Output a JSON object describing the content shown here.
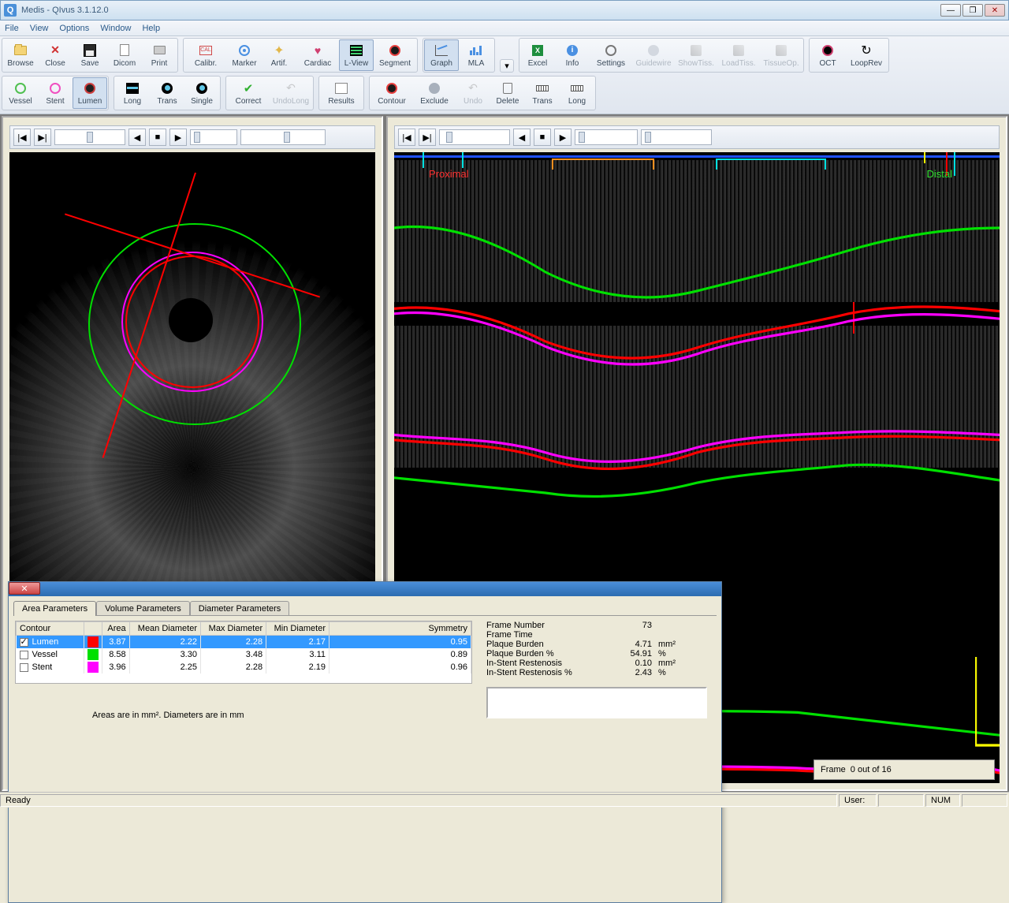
{
  "title": "Medis  -  QIvus 3.1.12.0",
  "menu": [
    "File",
    "View",
    "Options",
    "Window",
    "Help"
  ],
  "toolbar1": {
    "g1": [
      {
        "id": "browse",
        "label": "Browse",
        "icon": "ifolder"
      },
      {
        "id": "close",
        "label": "Close",
        "icon": "ix"
      },
      {
        "id": "save",
        "label": "Save",
        "icon": "idisk"
      },
      {
        "id": "dicom",
        "label": "Dicom",
        "icon": "idoc"
      },
      {
        "id": "print",
        "label": "Print",
        "icon": "iprint"
      }
    ],
    "g2": [
      {
        "id": "calibr",
        "label": "Calibr.",
        "icon": "ical"
      },
      {
        "id": "marker",
        "label": "Marker",
        "icon": "imark"
      },
      {
        "id": "artif",
        "label": "Artif.",
        "icon": "istar"
      },
      {
        "id": "cardiac",
        "label": "Cardiac",
        "icon": "iheart"
      },
      {
        "id": "lview",
        "label": "L-View",
        "icon": "ilview",
        "tog": true
      },
      {
        "id": "segment",
        "label": "Segment",
        "icon": "iseg"
      }
    ],
    "g3": [
      {
        "id": "graph",
        "label": "Graph",
        "icon": "igraph",
        "tog": true
      },
      {
        "id": "mla",
        "label": "MLA",
        "icon": "imla"
      }
    ],
    "g4": [
      {
        "id": "excel",
        "label": "Excel",
        "icon": "ixl"
      },
      {
        "id": "info",
        "label": "Info",
        "icon": "iinfo"
      },
      {
        "id": "settings",
        "label": "Settings",
        "icon": "igear"
      },
      {
        "id": "guidewire",
        "label": "Guidewire",
        "icon": "icircle",
        "disabled": true
      },
      {
        "id": "showtiss",
        "label": "ShowTiss.",
        "icon": "itool",
        "disabled": true
      },
      {
        "id": "loadtiss",
        "label": "LoadTiss.",
        "icon": "itool",
        "disabled": true
      },
      {
        "id": "tissueop",
        "label": "TissueOp.",
        "icon": "itool",
        "disabled": true
      }
    ],
    "g5": [
      {
        "id": "oct",
        "label": "OCT",
        "icon": "ioct"
      },
      {
        "id": "looprev",
        "label": "LoopRev",
        "icon": "iloop"
      }
    ]
  },
  "toolbar2": {
    "g1": [
      {
        "id": "vessel",
        "label": "Vessel",
        "icon": "il1"
      },
      {
        "id": "stent",
        "label": "Stent",
        "icon": "il2"
      },
      {
        "id": "lumen",
        "label": "Lumen",
        "icon": "il3",
        "tog": true
      }
    ],
    "g2": [
      {
        "id": "long",
        "label": "Long",
        "icon": "ilong"
      },
      {
        "id": "trans",
        "label": "Trans",
        "icon": "itrans"
      },
      {
        "id": "single",
        "label": "Single",
        "icon": "itrans"
      }
    ],
    "g3": [
      {
        "id": "correct",
        "label": "Correct",
        "icon": "icheck"
      },
      {
        "id": "undolong",
        "label": "UndoLong",
        "icon": "iundo",
        "disabled": true
      }
    ],
    "g4": [
      {
        "id": "results",
        "label": "Results",
        "icon": "ires"
      }
    ],
    "g5": [
      {
        "id": "contourd",
        "label": "Contour",
        "icon": "iseg"
      },
      {
        "id": "exclude",
        "label": "Exclude",
        "icon": "icircle"
      },
      {
        "id": "undo",
        "label": "Undo",
        "icon": "iundo",
        "disabled": true
      },
      {
        "id": "delete",
        "label": "Delete",
        "icon": "idel"
      },
      {
        "id": "transm",
        "label": "Trans",
        "icon": "imeasure"
      },
      {
        "id": "longm",
        "label": "Long",
        "icon": "imeasure"
      }
    ]
  },
  "long_view": {
    "proximal": "Proximal",
    "distal": "Distal",
    "frame_label": "Frame",
    "frame_text": "0 out of 16"
  },
  "colors": {
    "lumen": "#ff0000",
    "vessel": "#00e000",
    "stent": "#ff00ff",
    "cyan": "#00e0e0",
    "orange": "#ff9020",
    "yellow": "#ffff00"
  },
  "dialog": {
    "tabs": [
      "Area Parameters",
      "Volume Parameters",
      "Diameter Parameters"
    ],
    "active_tab": 0,
    "headers": [
      "Contour",
      "",
      "Area",
      "Mean Diameter",
      "Max Diameter",
      "Min Diameter",
      "Symmetry"
    ],
    "rows": [
      {
        "checked": true,
        "name": "Lumen",
        "color": "#ff0000",
        "area": "3.87",
        "mean": "2.22",
        "max": "2.28",
        "min": "2.17",
        "sym": "0.95",
        "sel": true
      },
      {
        "checked": false,
        "name": "Vessel",
        "color": "#00e000",
        "area": "8.58",
        "mean": "3.30",
        "max": "3.48",
        "min": "3.11",
        "sym": "0.89"
      },
      {
        "checked": false,
        "name": "Stent",
        "color": "#ff00ff",
        "area": "3.96",
        "mean": "2.25",
        "max": "2.28",
        "min": "2.19",
        "sym": "0.96"
      }
    ],
    "note": "Areas are in mm². Diameters are in mm",
    "info": [
      {
        "k": "Frame Number",
        "v": "73",
        "u": ""
      },
      {
        "k": "Frame Time",
        "v": "",
        "u": ""
      },
      {
        "k": "Plaque Burden",
        "v": "4.71",
        "u": "mm²"
      },
      {
        "k": "Plaque Burden %",
        "v": "54.91",
        "u": "%"
      },
      {
        "k": "In-Stent Restenosis",
        "v": "0.10",
        "u": "mm²"
      },
      {
        "k": "In-Stent Restenosis %",
        "v": "2.43",
        "u": "%"
      }
    ]
  },
  "status": {
    "ready": "Ready",
    "user": "User:",
    "num": "NUM"
  }
}
